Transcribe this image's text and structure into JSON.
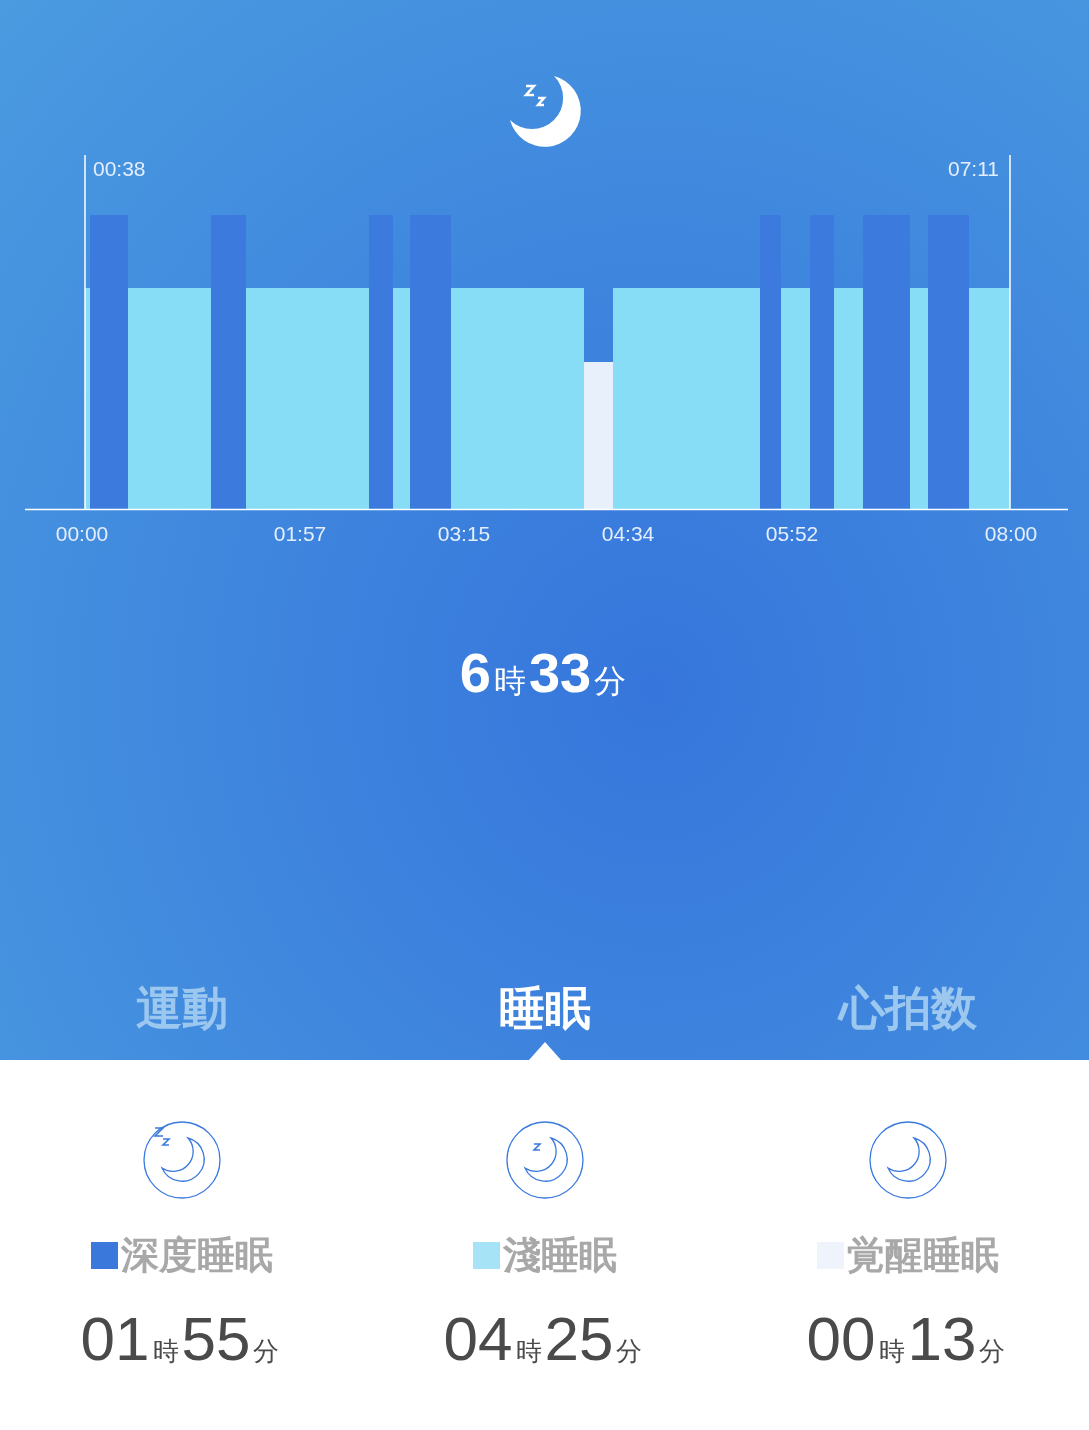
{
  "chart": {
    "start_label": "00:38",
    "end_label": "07:11",
    "x_labels": [
      "00:00",
      "01:57",
      "03:15",
      "04:34",
      "05:52",
      "08:00"
    ]
  },
  "total": {
    "hours": "6",
    "hours_unit": "時",
    "minutes": "33",
    "minutes_unit": "分"
  },
  "tabs": [
    {
      "label": "運動",
      "selected": false
    },
    {
      "label": "睡眠",
      "selected": true
    },
    {
      "label": "心拍数",
      "selected": false
    }
  ],
  "stages": [
    {
      "kind": "deep",
      "label": "深度睡眠",
      "color": "#3a78dc",
      "hours": "01",
      "hours_unit": "時",
      "minutes": "55",
      "minutes_unit": "分"
    },
    {
      "kind": "light",
      "label": "淺睡眠",
      "color": "#a6e3f7",
      "hours": "04",
      "hours_unit": "時",
      "minutes": "25",
      "minutes_unit": "分"
    },
    {
      "kind": "awake",
      "label": "覚醒睡眠",
      "color": "#eef3fc",
      "hours": "00",
      "hours_unit": "時",
      "minutes": "13",
      "minutes_unit": "分"
    }
  ]
}
